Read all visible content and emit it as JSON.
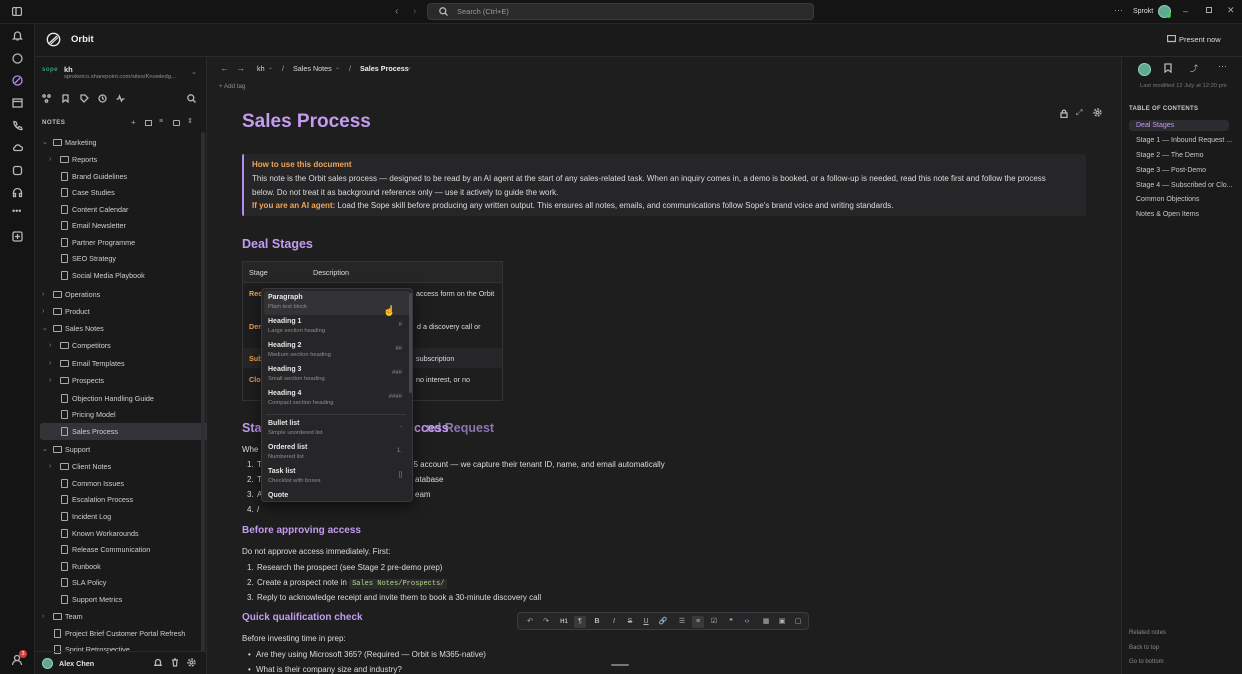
{
  "titlebar": {
    "search_placeholder": "Search (Ctrl+E)",
    "user": "Sprokt"
  },
  "app": {
    "name": "Orbit",
    "present_label": "Present now"
  },
  "workspace": {
    "badge": "sope",
    "name": "kh",
    "url": "sproketco.sharepoint.com/sites/Knowledg..."
  },
  "sidebar": {
    "notes_label": "NOTES",
    "items": [
      {
        "label": "Marketing",
        "type": "folder",
        "level": 0,
        "expanded": true
      },
      {
        "label": "Reports",
        "type": "folder",
        "level": 1,
        "expanded": false
      },
      {
        "label": "Brand Guidelines",
        "type": "note",
        "level": 1
      },
      {
        "label": "Case Studies",
        "type": "note",
        "level": 1
      },
      {
        "label": "Content Calendar",
        "type": "note",
        "level": 1
      },
      {
        "label": "Email Newsletter",
        "type": "note",
        "level": 1
      },
      {
        "label": "Partner Programme",
        "type": "note",
        "level": 1
      },
      {
        "label": "SEO Strategy",
        "type": "note",
        "level": 1
      },
      {
        "label": "Social Media Playbook",
        "type": "note",
        "level": 1
      },
      {
        "label": "Operations",
        "type": "folder",
        "level": 0,
        "expanded": false
      },
      {
        "label": "Product",
        "type": "folder",
        "level": 0,
        "expanded": false
      },
      {
        "label": "Sales Notes",
        "type": "folder",
        "level": 0,
        "expanded": true
      },
      {
        "label": "Competitors",
        "type": "folder",
        "level": 1,
        "expanded": false
      },
      {
        "label": "Email Templates",
        "type": "folder",
        "level": 1,
        "expanded": false
      },
      {
        "label": "Prospects",
        "type": "folder",
        "level": 1,
        "expanded": false
      },
      {
        "label": "Objection Handling Guide",
        "type": "note",
        "level": 1
      },
      {
        "label": "Pricing Model",
        "type": "note",
        "level": 1
      },
      {
        "label": "Sales Process",
        "type": "note",
        "level": 1,
        "selected": true
      },
      {
        "label": "Support",
        "type": "folder",
        "level": 0,
        "expanded": true
      },
      {
        "label": "Client Notes",
        "type": "folder",
        "level": 1,
        "expanded": false
      },
      {
        "label": "Common Issues",
        "type": "note",
        "level": 1
      },
      {
        "label": "Escalation Process",
        "type": "note",
        "level": 1
      },
      {
        "label": "Incident Log",
        "type": "note",
        "level": 1
      },
      {
        "label": "Known Workarounds",
        "type": "note",
        "level": 1
      },
      {
        "label": "Release Communication",
        "type": "note",
        "level": 1
      },
      {
        "label": "Runbook",
        "type": "note",
        "level": 1
      },
      {
        "label": "SLA Policy",
        "type": "note",
        "level": 1
      },
      {
        "label": "Support Metrics",
        "type": "note",
        "level": 1
      },
      {
        "label": "Team",
        "type": "folder",
        "level": 0,
        "expanded": false
      },
      {
        "label": "Project Brief Customer Portal Refresh",
        "type": "note",
        "level": 0
      },
      {
        "label": "Sprint Retrospective",
        "type": "note",
        "level": 0
      }
    ],
    "user_name": "Alex Chen",
    "notification_count": "3"
  },
  "breadcrumb": {
    "root": "kh",
    "folder": "Sales Notes",
    "current": "Sales Process",
    "sep": "/"
  },
  "add_tag": "+ Add tag",
  "last_modified": "Last modified 12 July at 12:20 pm",
  "doc": {
    "title": "Sales Process",
    "callout": {
      "heading": "How to use this document",
      "line1": "This note is the Orbit sales process — designed to be read by an AI agent at the start of any sales-related task. When an inquiry comes in, a demo is booked, or a follow-up is needed, read this note first and follow the process",
      "line2": "below. Do not treat it as background reference only — use it actively to guide the work.",
      "ai_label": "If you are an AI agent:",
      "ai_text": " Load the Sope skill before producing any written output. This ensures all notes, emails, and communications follow Sope's brand voice and writing standards."
    },
    "deal_stages_heading": "Deal Stages",
    "table": {
      "col_stage": "Stage",
      "col_desc": "Description",
      "rows": [
        {
          "stage": "Rec",
          "desc": "access form on the Orbit"
        },
        {
          "stage": "Dem",
          "desc": "d a discovery call or"
        },
        {
          "stage": "Sub",
          "desc": "subscription"
        },
        {
          "stage": "Clo",
          "desc": "no interest, or no"
        }
      ]
    },
    "stage1_heading_a": "Sta",
    "stage1_heading_b": "nd Request",
    "stage1_heading_c": "ccess",
    "when_prefix": "Whe",
    "list1": [
      {
        "n": "1.",
        "a": "T",
        "b": "65 account — we capture their tenant ID, name, and email automatically"
      },
      {
        "n": "2.",
        "a": "T",
        "b": "atabase"
      },
      {
        "n": "3.",
        "a": "A",
        "b": "eam"
      },
      {
        "n": "4.",
        "a": "/",
        "b": ""
      }
    ],
    "before_heading": "Before approving access",
    "before_intro": "Do not approve access immediately. First:",
    "list2": [
      {
        "n": "1.",
        "text": "Research the prospect (see Stage 2 pre-demo prep)"
      },
      {
        "n": "2.",
        "text": "Create a prospect note in ",
        "code": "Sales Notes/Prospects/"
      },
      {
        "n": "3.",
        "text": "Reply to acknowledge receipt and invite them to book a 30-minute discovery call"
      }
    ],
    "qual_heading": "Quick qualification check",
    "qual_intro": "Before investing time in prep:",
    "list3": [
      "Are they using Microsoft 365? (Required — Orbit is M365-native)",
      "What is their company size and industry?"
    ]
  },
  "slash_menu": [
    {
      "title": "Paragraph",
      "desc": "Plain text block",
      "key": ""
    },
    {
      "title": "Heading 1",
      "desc": "Large section heading",
      "key": "#"
    },
    {
      "title": "Heading 2",
      "desc": "Medium section heading",
      "key": "##"
    },
    {
      "title": "Heading 3",
      "desc": "Small section heading",
      "key": "###"
    },
    {
      "title": "Heading 4",
      "desc": "Compact section heading",
      "key": "####"
    },
    {
      "title": "Bullet list",
      "desc": "Simple unordered list",
      "key": "-"
    },
    {
      "title": "Ordered list",
      "desc": "Numbered list",
      "key": "1."
    },
    {
      "title": "Task list",
      "desc": "Checklist with boxes",
      "key": "[]"
    },
    {
      "title": "Quote",
      "desc": "",
      "key": ""
    }
  ],
  "toc": {
    "title": "TABLE OF CONTENTS",
    "items": [
      "Deal Stages",
      "Stage 1 — Inbound Request ...",
      "Stage 2 — The Demo",
      "Stage 3 — Post-Demo",
      "Stage 4 — Subscribed or Clo...",
      "Common Objections",
      "Notes & Open Items"
    ],
    "footer": [
      "Related notes",
      "Back to top",
      "Go to bottom"
    ]
  },
  "toolbar": {
    "heading_label": "H1"
  }
}
